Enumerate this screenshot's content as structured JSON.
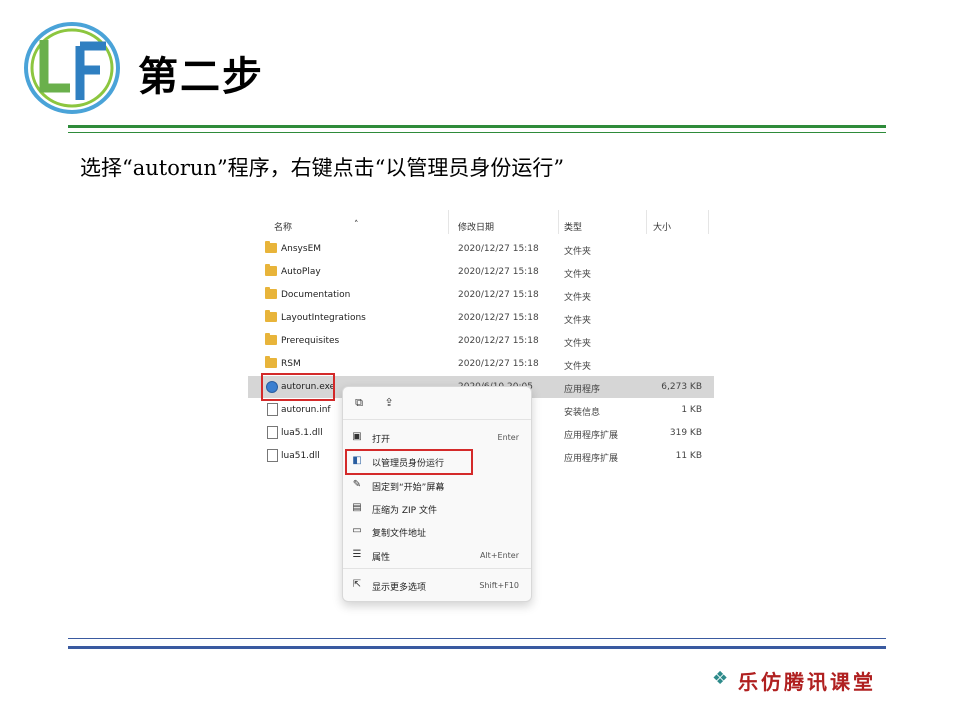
{
  "slide": {
    "logo_text": "LF",
    "title": "第二步",
    "instruction": "选择“autorun”程序，右键点击“以管理员身份运行”",
    "brand_text": "乐仿腾讯课堂",
    "brand_icon": "diamond-cluster-icon"
  },
  "explorer": {
    "columns": {
      "name": "名称",
      "modified": "修改日期",
      "type": "类型",
      "size": "大小"
    },
    "rows": [
      {
        "name": "AnsysEM",
        "modified": "2020/12/27 15:18",
        "type": "文件夹",
        "size": "",
        "icon": "folder-icon"
      },
      {
        "name": "AutoPlay",
        "modified": "2020/12/27 15:18",
        "type": "文件夹",
        "size": "",
        "icon": "folder-icon"
      },
      {
        "name": "Documentation",
        "modified": "2020/12/27 15:18",
        "type": "文件夹",
        "size": "",
        "icon": "folder-icon"
      },
      {
        "name": "LayoutIntegrations",
        "modified": "2020/12/27 15:18",
        "type": "文件夹",
        "size": "",
        "icon": "folder-icon"
      },
      {
        "name": "Prerequisites",
        "modified": "2020/12/27 15:18",
        "type": "文件夹",
        "size": "",
        "icon": "folder-icon"
      },
      {
        "name": "RSM",
        "modified": "2020/12/27 15:18",
        "type": "文件夹",
        "size": "",
        "icon": "folder-icon"
      },
      {
        "name": "autorun.exe",
        "modified": "2020/6/10 20:05",
        "type": "应用程序",
        "size": "6,273 KB",
        "icon": "app-icon"
      },
      {
        "name": "autorun.inf",
        "modified": "",
        "type": "安装信息",
        "size": "1 KB",
        "icon": "settings-file-icon"
      },
      {
        "name": "lua5.1.dll",
        "modified": "",
        "type": "应用程序扩展",
        "size": "319 KB",
        "icon": "dll-file-icon"
      },
      {
        "name": "lua51.dll",
        "modified": "",
        "type": "应用程序扩展",
        "size": "11 KB",
        "icon": "dll-file-icon"
      }
    ]
  },
  "context_menu": {
    "top_icons": [
      "copy-icon",
      "share-icon"
    ],
    "items": [
      {
        "label": "打开",
        "shortcut": "Enter",
        "icon": "open-icon"
      },
      {
        "label": "以管理员身份运行",
        "shortcut": "",
        "icon": "shield-icon"
      },
      {
        "label": "固定到“开始”屏幕",
        "shortcut": "",
        "icon": "pin-icon"
      },
      {
        "label": "压缩为 ZIP 文件",
        "shortcut": "",
        "icon": "zip-icon"
      },
      {
        "label": "复制文件地址",
        "shortcut": "",
        "icon": "copy-path-icon"
      },
      {
        "label": "属性",
        "shortcut": "Alt+Enter",
        "icon": "properties-icon"
      },
      {
        "label": "显示更多选项",
        "shortcut": "Shift+F10",
        "icon": "more-options-icon"
      }
    ]
  },
  "colors": {
    "accent_green": "#2e8b3a",
    "accent_blue": "#3a5aa0",
    "highlight_red": "#d42a2a",
    "brand_red": "#b02020"
  }
}
